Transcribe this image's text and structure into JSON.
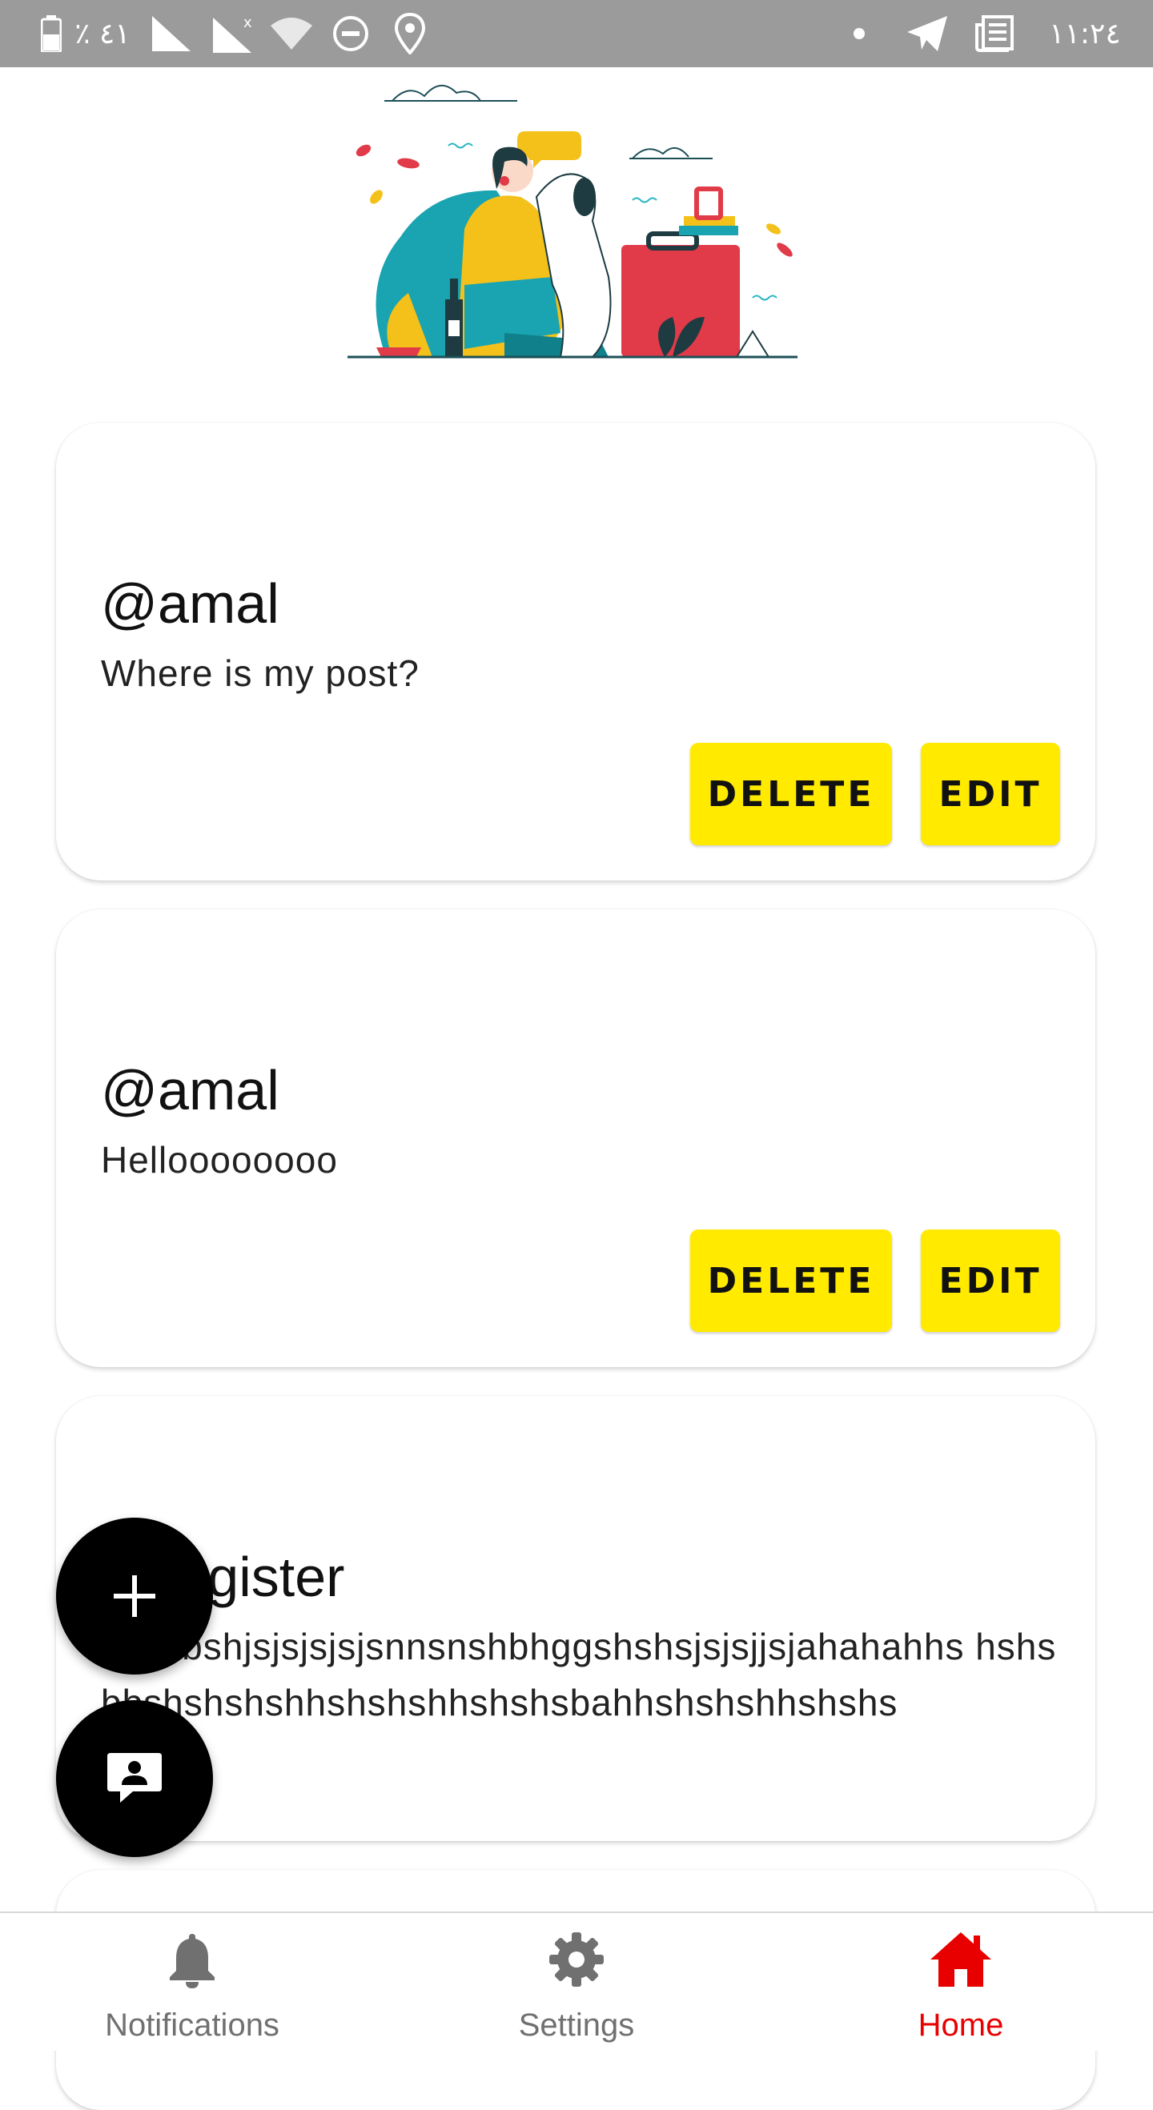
{
  "status_bar": {
    "battery_percent": "٪ ٤١",
    "time": "١١:٢٤",
    "background": "#9b9b9b"
  },
  "posts": [
    {
      "author": "@amal",
      "text": "Where is my post?",
      "delete_label": "DELETE",
      "edit_label": "EDIT"
    },
    {
      "author": "@amal",
      "text": "Helloooooooo",
      "delete_label": "DELETE",
      "edit_label": "EDIT"
    },
    {
      "author": "@register",
      "text": "hshsbshjsjsjsjsjsnnsnshbhggshshsjsjsjjsjahahahhs hshsbbshshshshhshshshhshshsbahhshshshhshshs"
    }
  ],
  "fabs": [
    {
      "icon": "plus-icon"
    },
    {
      "icon": "chat-person-icon"
    }
  ],
  "nav": {
    "items": [
      {
        "label": "Notifications",
        "icon": "bell-icon"
      },
      {
        "label": "Settings",
        "icon": "gear-icon"
      },
      {
        "label": "Home",
        "icon": "home-icon",
        "active": true
      }
    ]
  },
  "colors": {
    "accent_button": "#ffea00",
    "active_nav": "#e80000",
    "fab": "#000000"
  }
}
